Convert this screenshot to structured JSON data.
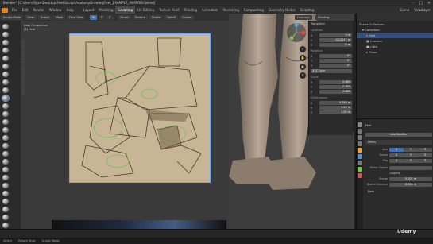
{
  "window": {
    "title": "Blender* [C:\\Users\\Ryan\\Desktop\\Feet\\Sculpt\\AnatomyDrawing\\Feet_EXAMPLE_ANATOMY.blend]"
  },
  "menu": {
    "items": [
      "File",
      "Edit",
      "Render",
      "Window",
      "Help"
    ],
    "workspace_tabs": [
      "Layout",
      "Modeling",
      "Sculpting",
      "UV Editing",
      "Texture Paint",
      "Shading",
      "Animation",
      "Rendering",
      "Compositing",
      "Geometry Nodes",
      "Scripting"
    ],
    "active_tab": "Sculpting",
    "scene": "Scene",
    "view_layer": "ViewLayer"
  },
  "sculpt_header": {
    "mode": "Sculpt Mode",
    "menus": [
      "View",
      "Sculpt",
      "Mask",
      "Face Sets"
    ],
    "brush_buttons": [
      "Brush",
      "Texture",
      "Stroke",
      "Falloff",
      "Cursor"
    ],
    "symmetry_x": "X",
    "symmetry_y": "Y",
    "symmetry_z": "Z"
  },
  "image_view": {
    "perspective_label": "User Perspective",
    "unit_label": "(1) Feet",
    "side_caption": "Relax for Beginners & Intermediate"
  },
  "viewport": {
    "header": [
      "Overlays",
      "Shading",
      "Xray"
    ],
    "gizmo_axes": {
      "x": "X",
      "y": "Y",
      "z": "Z"
    }
  },
  "n_panel": {
    "transform_title": "Transform",
    "location_title": "Location",
    "location": [
      {
        "axis": "X",
        "value": "0 m"
      },
      {
        "axis": "Y",
        "value": "-0.12147 m"
      },
      {
        "axis": "Z",
        "value": "0 m"
      }
    ],
    "rotation_title": "Rotation",
    "rotation": [
      {
        "axis": "X",
        "value": "0°"
      },
      {
        "axis": "Y",
        "value": "0°"
      },
      {
        "axis": "Z",
        "value": "0°"
      }
    ],
    "rotation_mode": "XYZ Euler",
    "scale_title": "Scale",
    "scale": [
      {
        "axis": "X",
        "value": "0.869"
      },
      {
        "axis": "Y",
        "value": "0.869"
      },
      {
        "axis": "Z",
        "value": "0.869"
      }
    ],
    "dimensions_title": "Dimensions",
    "dimensions": [
      {
        "axis": "X",
        "value": "0.798 m"
      },
      {
        "axis": "Y",
        "value": "1.04 m"
      },
      {
        "axis": "Z",
        "value": "1.00 m"
      }
    ],
    "tabs": [
      "Item",
      "Tool",
      "View"
    ]
  },
  "outliner": {
    "rows": [
      {
        "label": "Scene Collection",
        "indent": 0,
        "selected": false
      },
      {
        "label": "Collection",
        "indent": 1,
        "selected": false
      },
      {
        "label": "Feet",
        "indent": 2,
        "selected": true
      },
      {
        "label": "Camera",
        "indent": 2,
        "selected": false
      },
      {
        "label": "Light",
        "indent": 2,
        "selected": false
      },
      {
        "label": "Plane",
        "indent": 2,
        "selected": false
      }
    ]
  },
  "properties": {
    "object_name": "Feet",
    "add_modifier": "Add Modifier",
    "modifier_name": "Mirror",
    "axis_label": "Axis",
    "axis_values": [
      "X",
      "Y",
      "Z"
    ],
    "bisect_label": "Bisect",
    "flip_label": "Flip",
    "mirror_object_label": "Mirror Object",
    "clipping_label": "Clipping",
    "merge_label": "Merge",
    "merge_value": "0.001 m",
    "bisect_distance_label": "Bisect Distance",
    "bisect_distance_value": "0.001 m",
    "data_label": "Data"
  },
  "statusbar": {
    "items": [
      "Select",
      "Rotate View",
      "Sculpt Mode"
    ]
  },
  "watermark": "Udemy",
  "colors": {
    "accent_blue": "#4772b3",
    "selected_row": "#334d80",
    "panel_bg": "#2b2b2b",
    "viewport_bg": "#3d3d3d",
    "paper": "#c9b799"
  }
}
